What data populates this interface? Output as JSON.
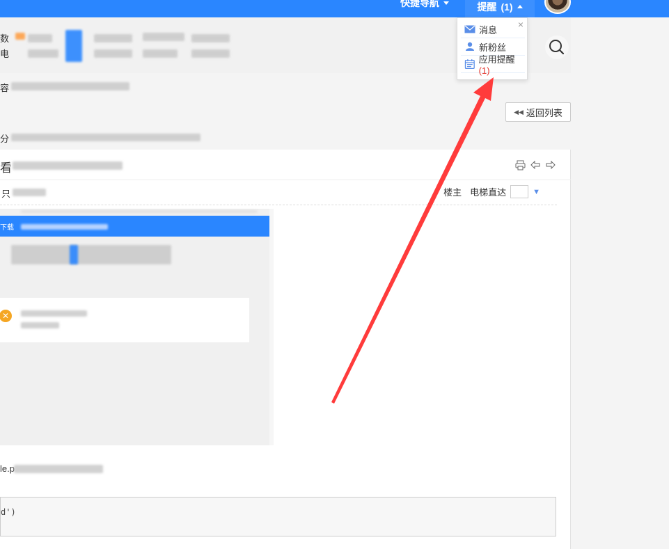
{
  "topbar": {
    "quick_nav_label": "快捷导航",
    "remind_label": "提醒",
    "remind_count": "(1)",
    "accent": "#2a86ff"
  },
  "header": {
    "edge_line1": "数",
    "edge_line2": "电"
  },
  "left_edges": {
    "content_label": "容",
    "category_label": "分",
    "view_label": "看",
    "only_label": "只",
    "file_edge": "le.p",
    "code_edge": "d')"
  },
  "back_button": {
    "label": "返回列表",
    "icon": "double-left-arrow-icon"
  },
  "post": {
    "floor_owner": "楼主",
    "elevator_label": "电梯直达",
    "elevator_value": "",
    "tools": [
      "print-icon",
      "prev-icon",
      "next-icon"
    ]
  },
  "screenshot": {
    "bar_text": "下载"
  },
  "dropdown": {
    "close": "×",
    "items": [
      {
        "label": "消息",
        "icon": "mail-icon",
        "count": ""
      },
      {
        "label": "新粉丝",
        "icon": "user-icon",
        "count": ""
      },
      {
        "label": "应用提醒",
        "icon": "calendar-icon",
        "count": "(1)"
      }
    ]
  },
  "colors": {
    "arrow": "#ff3b3b",
    "highlight_count": "#e2342b"
  }
}
